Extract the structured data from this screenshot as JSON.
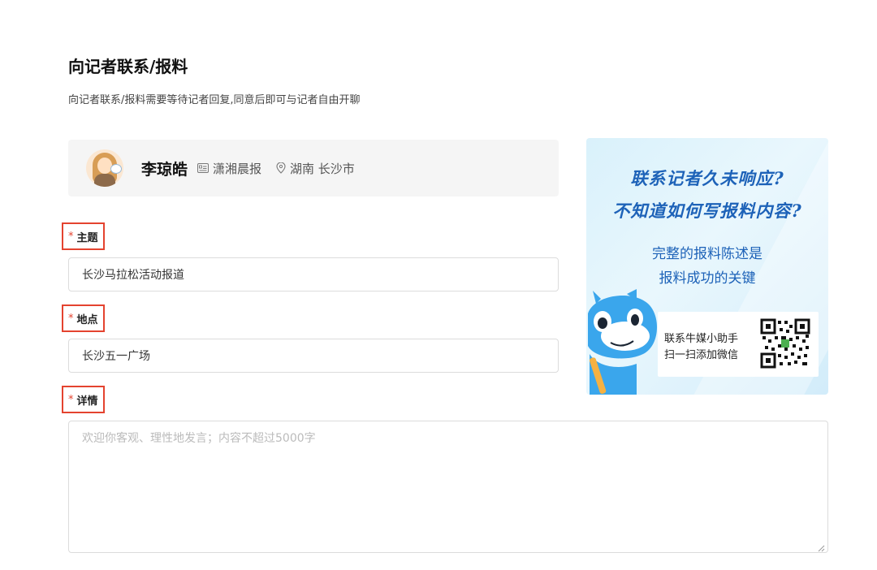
{
  "header": {
    "title": "向记者联系/报料",
    "subtitle": "向记者联系/报料需要等待记者回复,同意后即可与记者自由开聊"
  },
  "reporter": {
    "name": "李琼皓",
    "outlet": "潇湘晨报",
    "location": "湖南 长沙市",
    "outlet_icon": "id-card-icon",
    "location_icon": "location-pin-icon"
  },
  "form": {
    "required_mark": "*",
    "subject": {
      "label": "主题",
      "value": "长沙马拉松活动报道"
    },
    "place": {
      "label": "地点",
      "value": "长沙五一广场"
    },
    "details": {
      "label": "详情",
      "placeholder": "欢迎你客观、理性地发言；内容不超过5000字",
      "value": ""
    }
  },
  "banner": {
    "line1": "联系记者久未响应?",
    "line2": "不知道如何写报料内容?",
    "line3": "完整的报料陈述是",
    "line4": "报料成功的关键",
    "qr_line1": "联系牛媒小助手",
    "qr_line2": "扫一扫添加微信"
  },
  "colors": {
    "required": "#e4432f",
    "banner_text": "#1d62b8",
    "card_bg": "#f5f5f5"
  }
}
